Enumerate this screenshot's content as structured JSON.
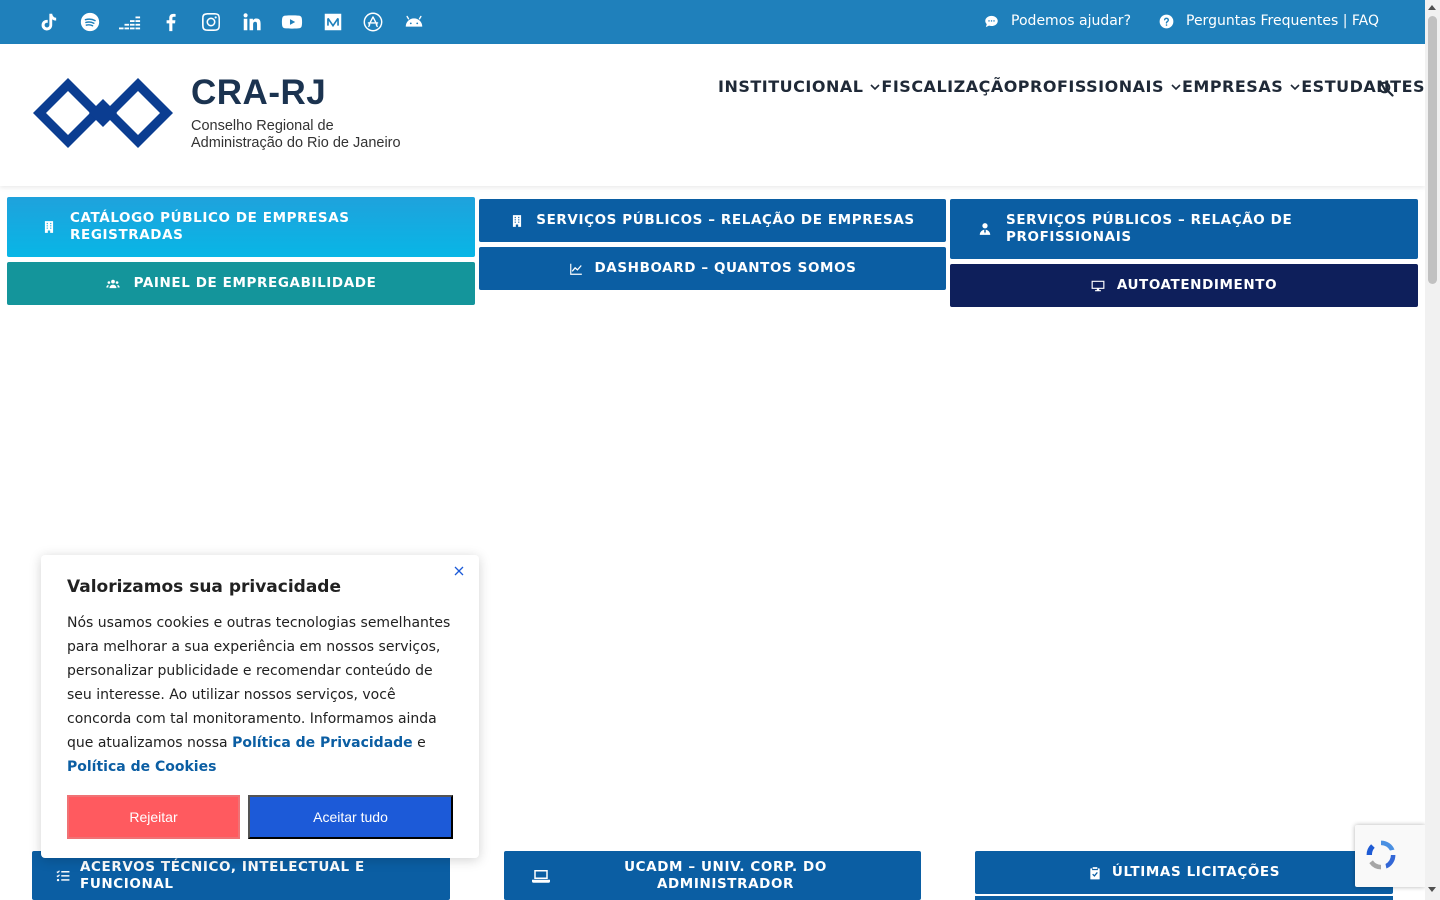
{
  "topbar": {
    "social_icons": [
      "tiktok-icon",
      "spotify-icon",
      "deezer-icon",
      "facebook-icon",
      "instagram-icon",
      "linkedin-icon",
      "youtube-icon",
      "medium-icon",
      "app-store-icon",
      "android-icon"
    ],
    "help_label": "Podemos ajudar?",
    "faq_label": "Perguntas Frequentes | FAQ"
  },
  "header": {
    "brand_title": "CRA-RJ",
    "brand_sub_1": "Conselho Regional de",
    "brand_sub_2": "Administração do Rio de Janeiro",
    "nav": [
      "INSTITUCIONAL",
      "FISCALIZAÇÃO",
      "PROFISSIONAIS",
      "EMPRESAS",
      "ESTUDANTES"
    ]
  },
  "quick_links": {
    "catalogo_1": "CATÁLOGO PÚBLICO DE EMPRESAS",
    "catalogo_2": "REGISTRADAS",
    "painel": "PAINEL DE EMPREGABILIDADE",
    "servicos_empresas": "SERVIÇOS PÚBLICOS – RELAÇÃO DE EMPRESAS",
    "dashboard": "DASHBOARD – QUANTOS SOMOS",
    "servicos_prof_1": "SERVIÇOS PÚBLICOS – RELAÇÃO DE",
    "servicos_prof_2": "PROFISSIONAIS",
    "autoatendimento": "AUTOATENDIMENTO",
    "acervos_1": "ACERVOS TÉCNICO, INTELECTUAL E",
    "acervos_2": "FUNCIONAL",
    "ucadm_1": "UCADM – UNIV. CORP. DO",
    "ucadm_2": "ADMINISTRADOR",
    "licitacoes": "ÚLTIMAS LICITAÇÕES"
  },
  "cookie": {
    "title": "Valorizamos sua privacidade",
    "text": "Nós usamos cookies e outras tecnologias semelhantes para melhorar a sua experiência em nossos serviços, personalizar publicidade e recomendar conteúdo de seu interesse. Ao utilizar nossos serviços, você concorda com tal monitoramento. Informamos ainda que atualizamos nossa",
    "link_privacy": "Política de Privacidade",
    "conjunction": "e",
    "link_cookies": "Política de Cookies",
    "reject": "Rejeitar",
    "accept": "Aceitar tudo"
  },
  "colors": {
    "topbar": "#1f80bb",
    "primary": "#0b5ea3",
    "teal": "#14959b",
    "navy": "#0e1f5b",
    "reject": "#ff5a5f",
    "accept": "#1c5ad8"
  }
}
